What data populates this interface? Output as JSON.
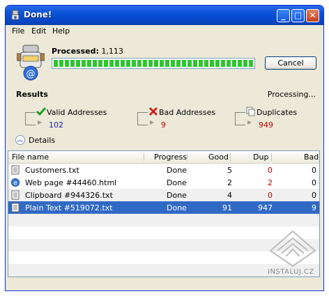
{
  "window": {
    "title": "Done!"
  },
  "menu": [
    "File",
    "Edit",
    "Help"
  ],
  "progress": {
    "label": "Processed:",
    "count": "1,113",
    "fraction": 1.0,
    "cancel_label": "Cancel"
  },
  "results": {
    "label": "Results",
    "status": "Processing...",
    "stats": [
      {
        "label": "Valid Addresses",
        "value": "102",
        "value_color": "#1b1bb4",
        "icon": "check-icon"
      },
      {
        "label": "Bad Addresses",
        "value": "9",
        "value_color": "#c00000",
        "icon": "red-x-icon"
      },
      {
        "label": "Duplicates",
        "value": "949",
        "value_color": "#c00000",
        "icon": "duplicates-icon"
      }
    ],
    "details_label": "Details"
  },
  "table": {
    "columns": [
      "File name",
      "Progress",
      "Good",
      "Dup",
      "Bad"
    ],
    "rows": [
      {
        "name": "Customers.txt",
        "progress": "Done",
        "good": "5",
        "dup": "0",
        "bad": "0",
        "icon": "text-file-icon",
        "dup_color": "#c00000"
      },
      {
        "name": "Web page #44460.html",
        "progress": "Done",
        "good": "2",
        "dup": "2",
        "bad": "0",
        "icon": "ie-page-icon",
        "dup_color": "#c00000"
      },
      {
        "name": "Clipboard #944326.txt",
        "progress": "Done",
        "good": "4",
        "dup": "0",
        "bad": "0",
        "icon": "text-file-icon",
        "dup_color": "#c00000"
      },
      {
        "name": "Plain Text #519072.txt",
        "progress": "Done",
        "good": "91",
        "dup": "947",
        "bad": "9",
        "icon": "text-file-icon",
        "selected": true
      }
    ]
  },
  "watermark": "INSTALUJ.CZ"
}
